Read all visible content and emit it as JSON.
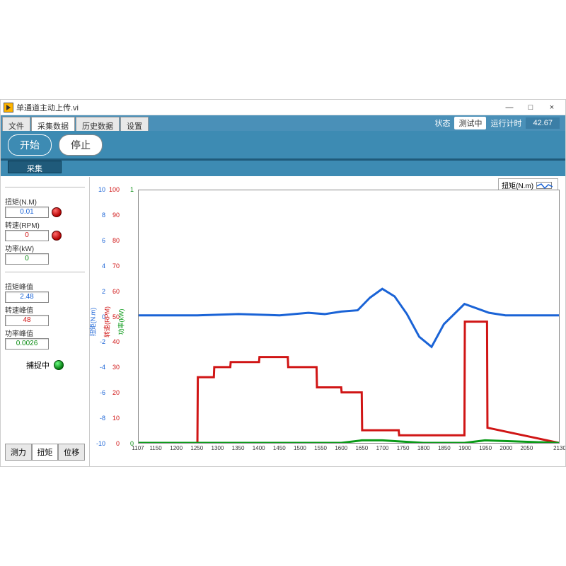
{
  "window": {
    "title": "单通道主动上传.vi",
    "min": "—",
    "max": "□",
    "close": "×"
  },
  "tabs": {
    "items": [
      "文件",
      "采集数据",
      "历史数据",
      "设置"
    ],
    "active": 1
  },
  "status": {
    "state_label": "状态",
    "state_value": "测试中",
    "runtime_label": "运行计时",
    "runtime_value": "42.67"
  },
  "toolbar": {
    "start": "开始",
    "stop": "停止",
    "collect": "采集"
  },
  "sidebar": {
    "metrics": [
      {
        "label": "扭矩(N.M)",
        "value": "0.01",
        "color": "blue",
        "led": true
      },
      {
        "label": "转速(RPM)",
        "value": "0",
        "color": "red",
        "led": true
      },
      {
        "label": "功率(kW)",
        "value": "0",
        "color": "green",
        "led": false
      }
    ],
    "peaks": [
      {
        "label": "扭矩峰值",
        "value": "2.48",
        "color": "blue"
      },
      {
        "label": "转速峰值",
        "value": "48",
        "color": "red"
      },
      {
        "label": "功率峰值",
        "value": "0.0026",
        "color": "green"
      }
    ],
    "capture_label": "捕捉中",
    "bottom_tabs": [
      "测力",
      "扭矩",
      "位移"
    ],
    "bottom_active": 1
  },
  "legend": [
    {
      "label": "扭矩(N.m)",
      "color": "#1a63d6"
    },
    {
      "label": "转速(RPM)",
      "color": "#d01515"
    },
    {
      "label": "功率",
      "color": "#0a9a18"
    }
  ],
  "chart_data": {
    "type": "line",
    "xlabel": "",
    "x_range": [
      1107,
      2130
    ],
    "x_ticks": [
      1107,
      1150,
      1200,
      1250,
      1300,
      1350,
      1400,
      1450,
      1500,
      1550,
      1600,
      1650,
      1700,
      1750,
      1800,
      1850,
      1900,
      1950,
      2000,
      2050,
      2130
    ],
    "series": [
      {
        "name": "扭矩(N.m)",
        "color": "#1a63d6",
        "y_range": [
          -10,
          10
        ],
        "y_ticks": [
          -10,
          -8,
          -6,
          -4,
          -2,
          0,
          2,
          4,
          6,
          8,
          10
        ],
        "ylabel": "扭矩(N.m)",
        "x": [
          1107,
          1250,
          1350,
          1450,
          1520,
          1560,
          1600,
          1640,
          1670,
          1700,
          1730,
          1760,
          1790,
          1820,
          1850,
          1900,
          1960,
          2000,
          2060,
          2130
        ],
        "values": [
          0.1,
          0.1,
          0.2,
          0.1,
          0.3,
          0.2,
          0.4,
          0.5,
          1.5,
          2.2,
          1.6,
          0.2,
          -1.6,
          -2.4,
          -0.6,
          1.0,
          0.3,
          0.1,
          0.1,
          0.1
        ]
      },
      {
        "name": "转速(RPM)",
        "color": "#d01515",
        "y_range": [
          0,
          100
        ],
        "y_ticks": [
          0,
          10,
          20,
          30,
          40,
          50,
          60,
          70,
          80,
          90,
          100
        ],
        "ylabel": "转速(RPM)",
        "x": [
          1107,
          1250,
          1251,
          1290,
          1291,
          1330,
          1331,
          1400,
          1401,
          1470,
          1471,
          1540,
          1541,
          1600,
          1601,
          1650,
          1651,
          1740,
          1741,
          1900,
          1901,
          1955,
          1956,
          2130
        ],
        "values": [
          0,
          0,
          26,
          26,
          30,
          30,
          32,
          32,
          34,
          34,
          30,
          30,
          22,
          22,
          20,
          20,
          5,
          5,
          3,
          3,
          48,
          48,
          6,
          0
        ]
      },
      {
        "name": "功率",
        "color": "#0a9a18",
        "y_range": [
          0,
          1
        ],
        "y_ticks": [
          0,
          1
        ],
        "ylabel": "功率(kW)",
        "x": [
          1107,
          1600,
          1650,
          1700,
          1800,
          1900,
          1950,
          2130
        ],
        "values": [
          0,
          0,
          0.01,
          0.01,
          0,
          0,
          0.01,
          0
        ]
      }
    ]
  }
}
